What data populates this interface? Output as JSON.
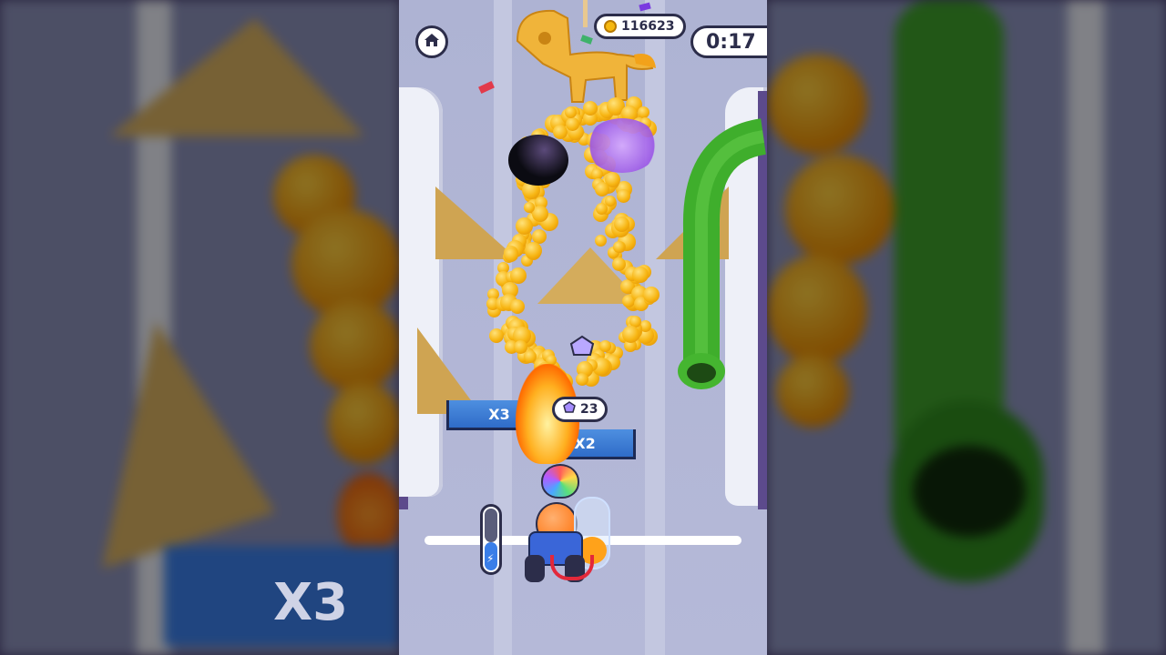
{
  "hud": {
    "home_icon": "home-icon",
    "coins": "116623",
    "timer": "0:17",
    "gem_count": "23"
  },
  "zones": {
    "left_multiplier": "X3",
    "right_multiplier": "X2",
    "backdrop_multiplier": "X3"
  },
  "player": {
    "energy_level": 0.45
  },
  "colors": {
    "coin": "#f6b80f",
    "pipe": "#3fae2c",
    "zone_blue": "#3a7ee8",
    "hud_outline": "#2c2d4a"
  }
}
